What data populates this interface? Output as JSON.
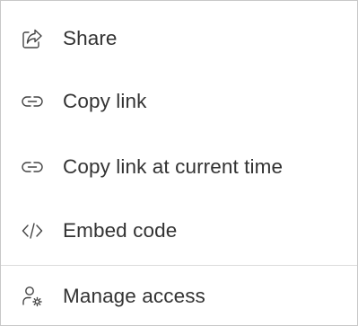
{
  "menu": {
    "items": [
      {
        "label": "Share",
        "icon": "share-icon"
      },
      {
        "label": "Copy link",
        "icon": "link-icon"
      },
      {
        "label": "Copy link at current time",
        "icon": "link-icon"
      },
      {
        "label": "Embed code",
        "icon": "code-icon"
      },
      {
        "label": "Manage access",
        "icon": "manage-access-icon"
      }
    ]
  },
  "colors": {
    "text": "#333333",
    "icon": "#444444",
    "border": "#c8c8c8",
    "divider": "#dcdcdc"
  }
}
